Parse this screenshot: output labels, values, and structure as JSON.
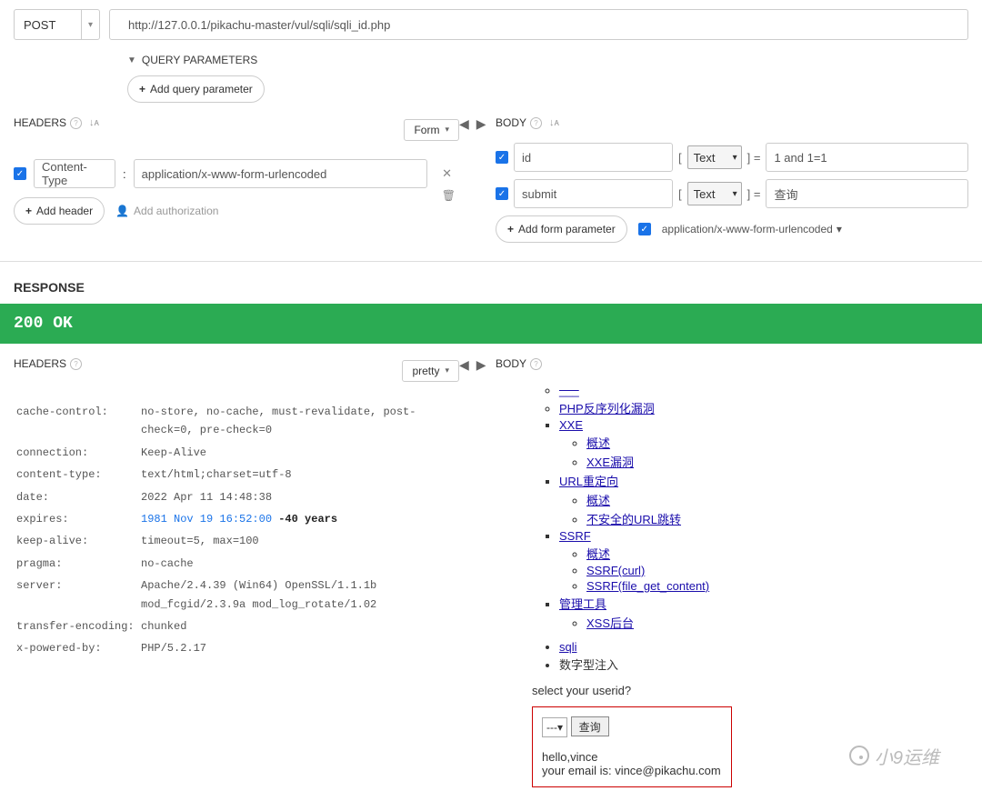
{
  "request": {
    "method": "POST",
    "url": "http://127.0.0.1/pikachu-master/vul/sqli/sqli_id.php",
    "queryParams": {
      "title": "QUERY PARAMETERS",
      "addBtn": "Add query parameter"
    },
    "headers": {
      "title": "HEADERS",
      "formatBtn": "Form",
      "rows": [
        {
          "checked": true,
          "name": "Content-Type",
          "value": "application/x-www-form-urlencoded"
        }
      ],
      "addHeaderBtn": "Add header",
      "addAuthBtn": "Add authorization"
    },
    "body": {
      "title": "BODY",
      "params": [
        {
          "checked": true,
          "name": "id",
          "type": "Text",
          "value": "1 and 1=1"
        },
        {
          "checked": true,
          "name": "submit",
          "type": "Text",
          "value": "查询"
        }
      ],
      "addParamBtn": "Add form parameter",
      "contentTypeChecked": true,
      "contentTypeLabel": "application/x-www-form-urlencoded"
    }
  },
  "response": {
    "title": "RESPONSE",
    "status": "200 OK",
    "headers": {
      "title": "HEADERS",
      "format": "pretty",
      "rows": [
        {
          "k": "cache-control:",
          "v": "no-store, no-cache, must-revalidate, post-check=0, pre-check=0"
        },
        {
          "k": "connection:",
          "v": "Keep-Alive"
        },
        {
          "k": "content-type:",
          "v": "text/html;charset=utf-8"
        },
        {
          "k": "date:",
          "v": "2022 Apr 11 14:48:38"
        },
        {
          "k": "expires:",
          "v": "1981 Nov 19 16:52:00",
          "diff": "-40 years"
        },
        {
          "k": "keep-alive:",
          "v": "timeout=5, max=100"
        },
        {
          "k": "pragma:",
          "v": "no-cache"
        },
        {
          "k": "server:",
          "v": "Apache/2.4.39 (Win64) OpenSSL/1.1.1b mod_fcgid/2.3.9a mod_log_rotate/1.02"
        },
        {
          "k": "transfer-encoding:",
          "v": "chunked"
        },
        {
          "k": "x-powered-by:",
          "v": "PHP/5.2.17"
        }
      ]
    },
    "body": {
      "title": "BODY",
      "nav": {
        "top_item": "___",
        "php_unser": "PHP反序列化漏洞",
        "xxe": "XXE",
        "xxe_over": "概述",
        "xxe_vuln": "XXE漏洞",
        "urlr": "URL重定向",
        "urlr_over": "概述",
        "urlr_unsafe": "不安全的URL跳转",
        "ssrf": "SSRF",
        "ssrf_over": "概述",
        "ssrf_curl": "SSRF(curl)",
        "ssrf_fgc": "SSRF(file_get_content)",
        "mgmt": "管理工具",
        "xss_back": "XSS后台",
        "sqli": "sqli",
        "num_inj": "数字型注入"
      },
      "prompt": "select your userid?",
      "selectPlaceholder": "---",
      "queryBtn": "查询",
      "hello": "hello,vince",
      "email": "your email is: vince@pikachu.com"
    }
  },
  "watermark": "小9运维"
}
